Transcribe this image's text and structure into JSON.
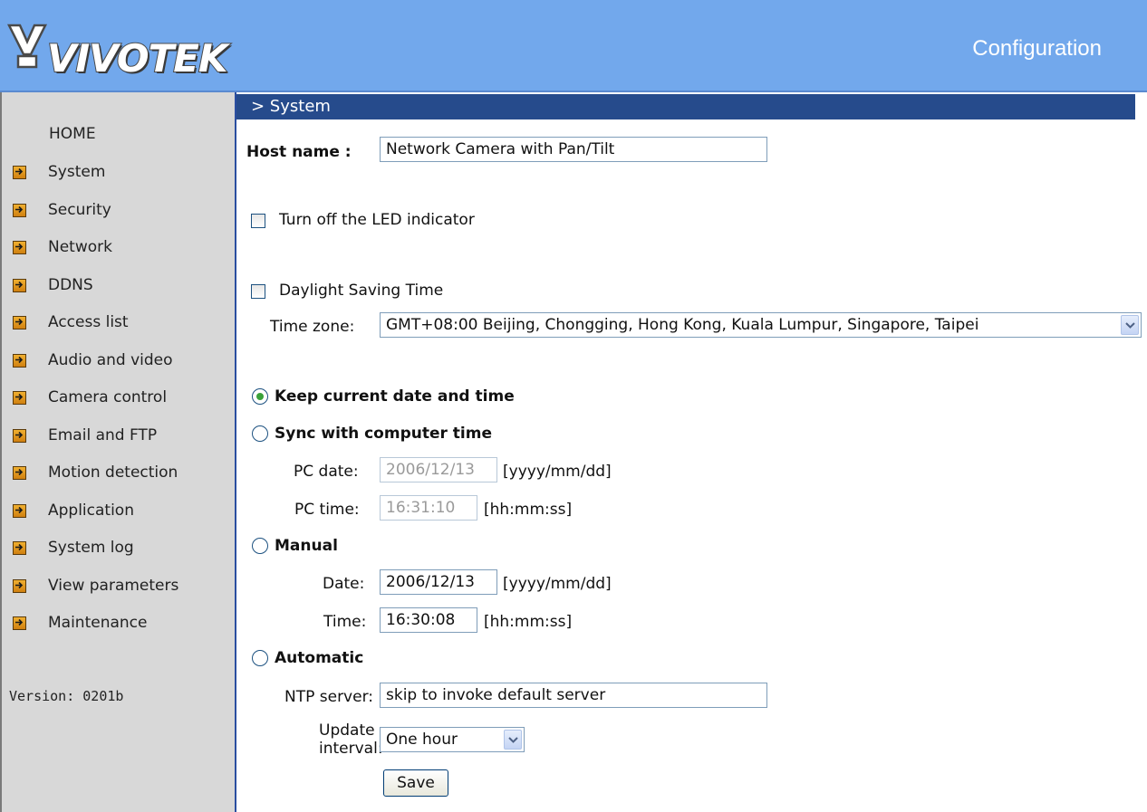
{
  "header": {
    "logo_text": "VIVOTEK",
    "title": "Configuration"
  },
  "sidebar": {
    "home": "HOME",
    "items": [
      {
        "label": "System"
      },
      {
        "label": "Security"
      },
      {
        "label": "Network"
      },
      {
        "label": "DDNS"
      },
      {
        "label": "Access list"
      },
      {
        "label": "Audio and video"
      },
      {
        "label": "Camera control"
      },
      {
        "label": "Email and FTP"
      },
      {
        "label": "Motion detection"
      },
      {
        "label": "Application"
      },
      {
        "label": "System log"
      },
      {
        "label": "View parameters"
      },
      {
        "label": "Maintenance"
      }
    ],
    "version": "Version: 0201b"
  },
  "section": {
    "title": "> System"
  },
  "form": {
    "host_name_label": "Host name :",
    "host_name_value": "Network Camera with Pan/Tilt",
    "led_label": "Turn off the LED indicator",
    "led_checked": false,
    "dst_label": "Daylight Saving Time",
    "dst_checked": false,
    "timezone_label": "Time zone:",
    "timezone_value": "GMT+08:00 Beijing, Chongging, Hong Kong, Kuala Lumpur, Singapore, Taipei",
    "keep_label": "Keep current date and time",
    "sync_label": "Sync with computer time",
    "pc_date_label": "PC date:",
    "pc_date_value": "2006/12/13",
    "pc_date_format": "[yyyy/mm/dd]",
    "pc_time_label": "PC time:",
    "pc_time_value": "16:31:10",
    "pc_time_format": "[hh:mm:ss]",
    "manual_label": "Manual",
    "date_label": "Date:",
    "date_value": "2006/12/13",
    "date_format": "[yyyy/mm/dd]",
    "time_label": "Time:",
    "time_value": "16:30:08",
    "time_format": "[hh:mm:ss]",
    "automatic_label": "Automatic",
    "ntp_label": "NTP server:",
    "ntp_value": "skip to invoke default server",
    "update_label_1": "Update",
    "update_label_2": "interval:",
    "update_value": "One hour",
    "save_label": "Save",
    "selected_mode": "Keep current date and time"
  }
}
